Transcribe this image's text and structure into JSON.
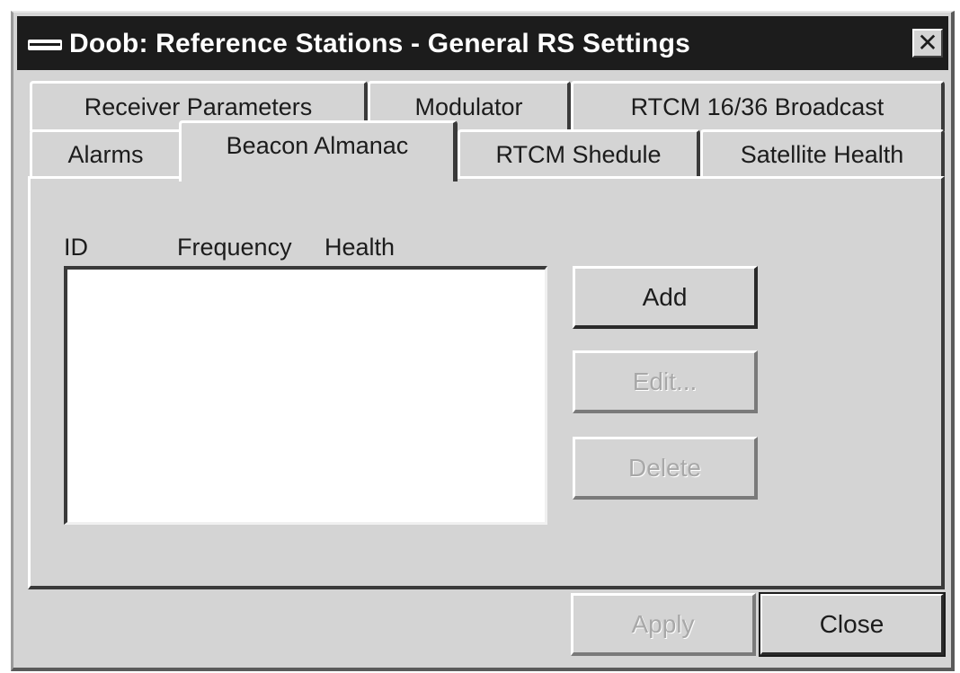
{
  "window": {
    "title": "Doob: Reference Stations - General RS Settings",
    "close_glyph": "✕"
  },
  "tabs": {
    "row_back": [
      {
        "label": "Receiver Parameters"
      },
      {
        "label": "Modulator"
      },
      {
        "label": "RTCM 16/36 Broadcast"
      }
    ],
    "row_front": [
      {
        "label": "Alarms"
      },
      {
        "label": "Beacon Almanac",
        "selected": true
      },
      {
        "label": "RTCM Shedule"
      },
      {
        "label": "Satellite Health"
      }
    ]
  },
  "almanac": {
    "columns": [
      "ID",
      "Frequency",
      "Health"
    ],
    "rows": []
  },
  "buttons": {
    "add": "Add",
    "edit": "Edit...",
    "delete": "Delete",
    "apply": "Apply",
    "close": "Close"
  },
  "colors": {
    "face": "#d4d4d4",
    "titlebar": "#1c1c1c",
    "disabled_text": "#a8a8a8"
  }
}
